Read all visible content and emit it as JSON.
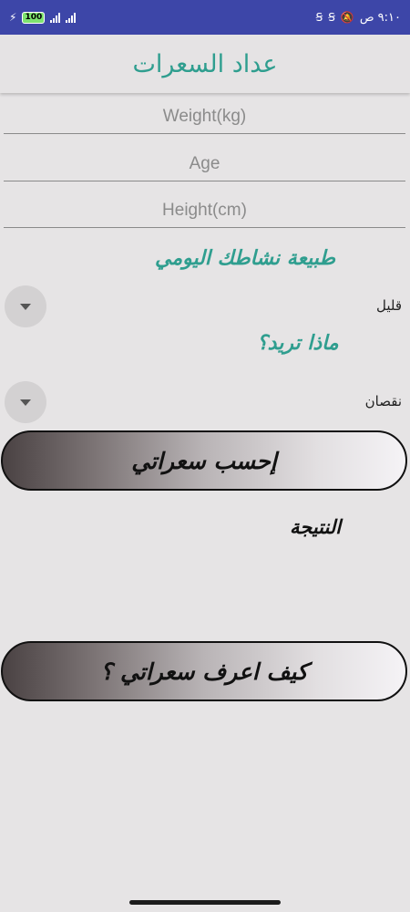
{
  "status_bar": {
    "time": "٩:١٠ ص",
    "battery": "100",
    "icons": [
      "charging-bolt-icon",
      "battery-icon",
      "signal-icon",
      "signal-icon",
      "vpn-icon",
      "vpn-icon",
      "mute-icon"
    ]
  },
  "app": {
    "title": "عداد السعرات",
    "accent_color": "#2f9e8f"
  },
  "form": {
    "weight_placeholder": "Weight(kg)",
    "age_placeholder": "Age",
    "height_placeholder": "Height(cm)",
    "activity_title": "طبيعة نشاطك اليومي",
    "activity_value": "قليل",
    "goal_title": "ماذا تريد؟",
    "goal_value": "نقصان"
  },
  "buttons": {
    "calculate_label": "إحسب سعراتي",
    "howto_label": "كيف اعرف سعراتي ؟"
  },
  "result": {
    "label": "النتيجة"
  }
}
